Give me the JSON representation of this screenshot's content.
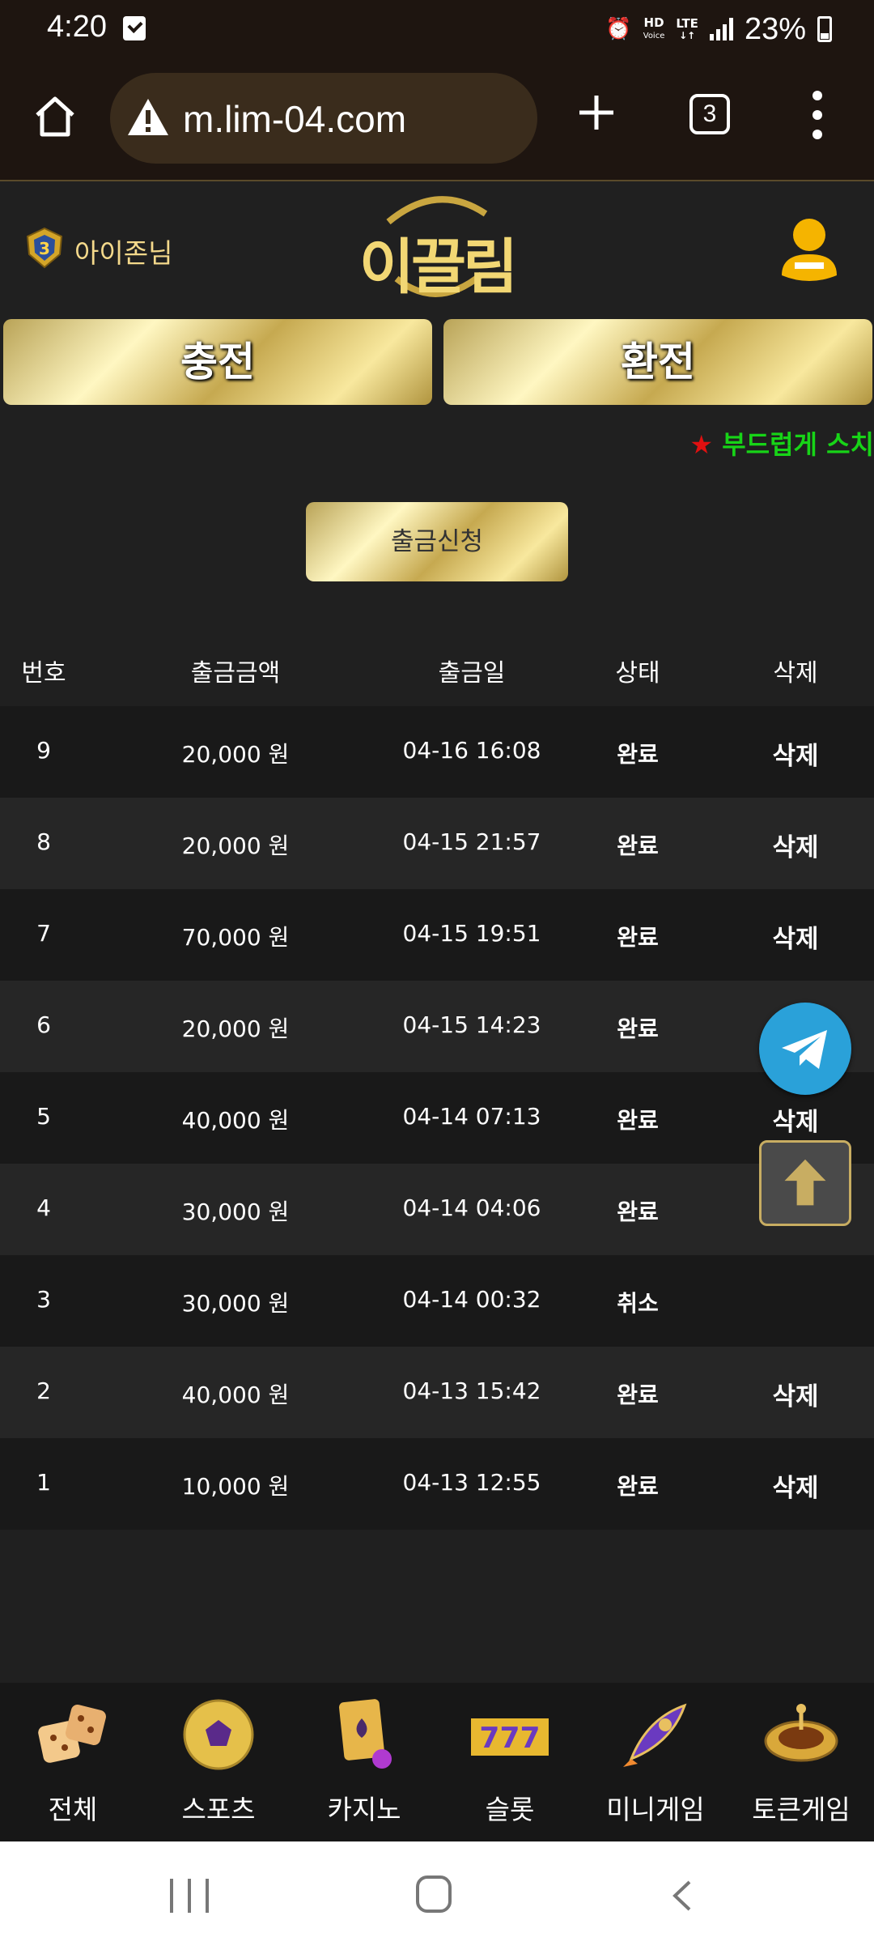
{
  "status_bar": {
    "time": "4:20",
    "hd_label": "HD",
    "voice_label": "Voice",
    "lte_label": "LTE",
    "battery": "23%"
  },
  "browser": {
    "url": "m.lim-04.com",
    "tab_count": "3"
  },
  "header": {
    "username": "아이존님",
    "logo_text": "이끌림",
    "rank_badge_text": "3"
  },
  "actions": {
    "charge_label": "충전",
    "exchange_label": "환전",
    "marquee_star": "★",
    "marquee_text": " 부드럽게 스치"
  },
  "withdraw_button_label": "출금신청",
  "table": {
    "headers": [
      "번호",
      "출금금액",
      "출금일",
      "상태",
      "삭제"
    ],
    "rows": [
      {
        "no": "9",
        "amount": "20,000 원",
        "date": "04-16 16:08",
        "status": "완료",
        "delete": "삭제"
      },
      {
        "no": "8",
        "amount": "20,000 원",
        "date": "04-15 21:57",
        "status": "완료",
        "delete": "삭제"
      },
      {
        "no": "7",
        "amount": "70,000 원",
        "date": "04-15 19:51",
        "status": "완료",
        "delete": "삭제"
      },
      {
        "no": "6",
        "amount": "20,000 원",
        "date": "04-15 14:23",
        "status": "완료",
        "delete": ""
      },
      {
        "no": "5",
        "amount": "40,000 원",
        "date": "04-14 07:13",
        "status": "완료",
        "delete": "삭제"
      },
      {
        "no": "4",
        "amount": "30,000 원",
        "date": "04-14 04:06",
        "status": "완료",
        "delete": ""
      },
      {
        "no": "3",
        "amount": "30,000 원",
        "date": "04-14 00:32",
        "status": "취소",
        "delete": ""
      },
      {
        "no": "2",
        "amount": "40,000 원",
        "date": "04-13 15:42",
        "status": "완료",
        "delete": "삭제"
      },
      {
        "no": "1",
        "amount": "10,000 원",
        "date": "04-13 12:55",
        "status": "완료",
        "delete": "삭제"
      }
    ]
  },
  "bottom_nav": [
    {
      "label": "전체",
      "icon": "dice-icon"
    },
    {
      "label": "스포츠",
      "icon": "soccer-ball-icon"
    },
    {
      "label": "카지노",
      "icon": "playing-cards-icon"
    },
    {
      "label": "슬롯",
      "icon": "slot-777-icon"
    },
    {
      "label": "미니게임",
      "icon": "rocket-icon"
    },
    {
      "label": "토큰게임",
      "icon": "roulette-icon"
    }
  ],
  "slot_icon_text": "777",
  "colors": {
    "gold": "#f2d774",
    "marquee_green": "#17d417",
    "marquee_star_red": "#e01010",
    "telegram_blue": "#2aa1d9",
    "background": "#202020"
  }
}
